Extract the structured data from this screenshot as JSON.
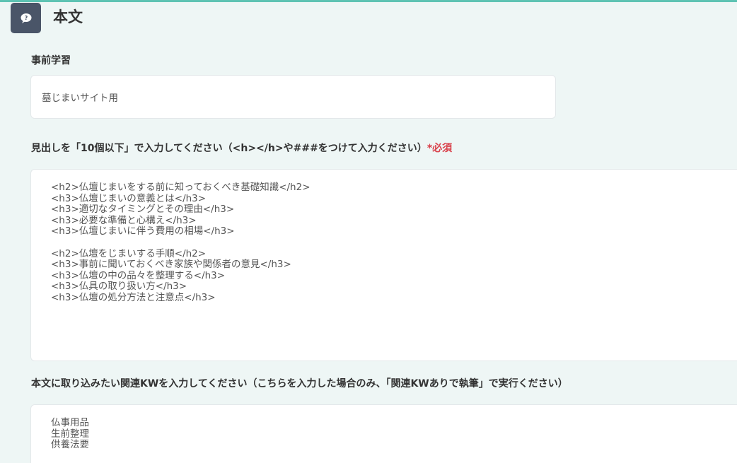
{
  "section": {
    "icon": "chat-bubble-icon",
    "title": "本文"
  },
  "prestudy": {
    "label": "事前学習",
    "value": "墓じまいサイト用"
  },
  "headings": {
    "label": "見出しを「10個以下」で入力してください（<h></h>や###をつけて入力ください）",
    "required": "*必須",
    "lines": [
      "<h2>仏壇じまいをする前に知っておくべき基礎知識</h2>",
      "<h3>仏壇じまいの意義とは</h3>",
      "<h3>適切なタイミングとその理由</h3>",
      "<h3>必要な準備と心構え</h3>",
      "<h3>仏壇じまいに伴う費用の相場</h3>",
      "",
      "<h2>仏壇をじまいする手順</h2>",
      "<h3>事前に聞いておくべき家族や関係者の意見</h3>",
      "<h3>仏壇の中の品々を整理する</h3>",
      "<h3>仏具の取り扱い方</h3>",
      "<h3>仏壇の処分方法と注意点</h3>"
    ]
  },
  "keywords": {
    "label": "本文に取り込みたい関連KWを入力してください（こちらを入力した場合のみ、「関連KWありで執筆」で実行ください）",
    "lines": [
      "仏事用品",
      "生前整理",
      "供養法要"
    ]
  }
}
